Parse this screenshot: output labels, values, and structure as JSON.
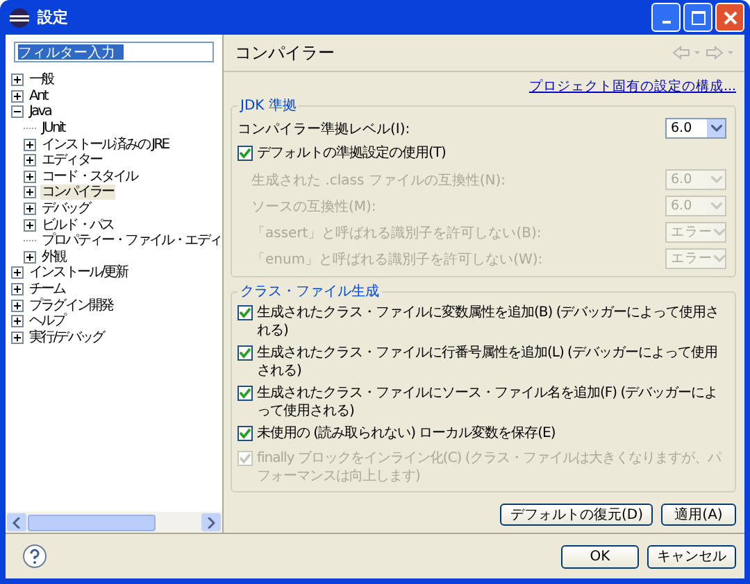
{
  "window": {
    "title": "設定"
  },
  "filter": {
    "value": "フィルター入力"
  },
  "tree": [
    {
      "label": "一般",
      "expandable": true,
      "expanded": false,
      "selected": false
    },
    {
      "label": "Ant",
      "expandable": true,
      "expanded": false,
      "selected": false
    },
    {
      "label": "Java",
      "expandable": true,
      "expanded": true,
      "selected": false,
      "children": [
        {
          "label": "JUnit",
          "expandable": false,
          "selected": false
        },
        {
          "label": "インストール済みの JRE",
          "expandable": true,
          "expanded": false,
          "selected": false
        },
        {
          "label": "エディター",
          "expandable": true,
          "expanded": false,
          "selected": false
        },
        {
          "label": "コード・スタイル",
          "expandable": true,
          "expanded": false,
          "selected": false
        },
        {
          "label": "コンパイラー",
          "expandable": true,
          "expanded": false,
          "selected": true
        },
        {
          "label": "デバッグ",
          "expandable": true,
          "expanded": false,
          "selected": false
        },
        {
          "label": "ビルド・パス",
          "expandable": true,
          "expanded": false,
          "selected": false
        },
        {
          "label": "プロパティー・ファイル・エディ",
          "expandable": false,
          "selected": false
        },
        {
          "label": "外観",
          "expandable": true,
          "expanded": false,
          "selected": false
        }
      ]
    },
    {
      "label": "インストール/更新",
      "expandable": true,
      "expanded": false,
      "selected": false
    },
    {
      "label": "チーム",
      "expandable": true,
      "expanded": false,
      "selected": false
    },
    {
      "label": "プラグイン開発",
      "expandable": true,
      "expanded": false,
      "selected": false
    },
    {
      "label": "ヘルプ",
      "expandable": true,
      "expanded": false,
      "selected": false
    },
    {
      "label": "実行/デバッグ",
      "expandable": true,
      "expanded": false,
      "selected": false
    }
  ],
  "page": {
    "title": "コンパイラー",
    "link": "プロジェクト固有の設定の構成..."
  },
  "jdk": {
    "title": "JDK 準拠",
    "level_label": "コンパイラー準拠レベル(I):",
    "level_value": "6.0",
    "default_checkbox": {
      "label": "デフォルトの準拠設定の使用(T)",
      "checked": true,
      "disabled": false
    },
    "rows": [
      {
        "label": "生成された .class ファイルの互換性(N):",
        "value": "6.0",
        "disabled": true
      },
      {
        "label": "ソースの互換性(M):",
        "value": "6.0",
        "disabled": true
      },
      {
        "label": "「assert」と呼ばれる識別子を許可しない(B):",
        "value": "エラー",
        "disabled": true
      },
      {
        "label": "「enum」と呼ばれる識別子を許可しない(W):",
        "value": "エラー",
        "disabled": true
      }
    ]
  },
  "classfile": {
    "title": "クラス・ファイル生成",
    "options": [
      {
        "label": "生成されたクラス・ファイルに変数属性を追加(B) (デバッガーによって使用される)",
        "checked": true,
        "disabled": false
      },
      {
        "label": "生成されたクラス・ファイルに行番号属性を追加(L) (デバッガーによって使用される)",
        "checked": true,
        "disabled": false
      },
      {
        "label": "生成されたクラス・ファイルにソース・ファイル名を追加(F) (デバッガーによって使用される)",
        "checked": true,
        "disabled": false
      },
      {
        "label": "未使用の (読み取られない) ローカル変数を保存(E)",
        "checked": true,
        "disabled": false
      },
      {
        "label": "finally ブロックをインライン化(C) (クラス・ファイルは大きくなりますが、パフォーマンスは向上します)",
        "checked": true,
        "disabled": true
      }
    ]
  },
  "page_buttons": [
    "デフォルトの復元(D)",
    "適用(A)"
  ],
  "buttons": [
    "OK",
    "キャンセル"
  ]
}
